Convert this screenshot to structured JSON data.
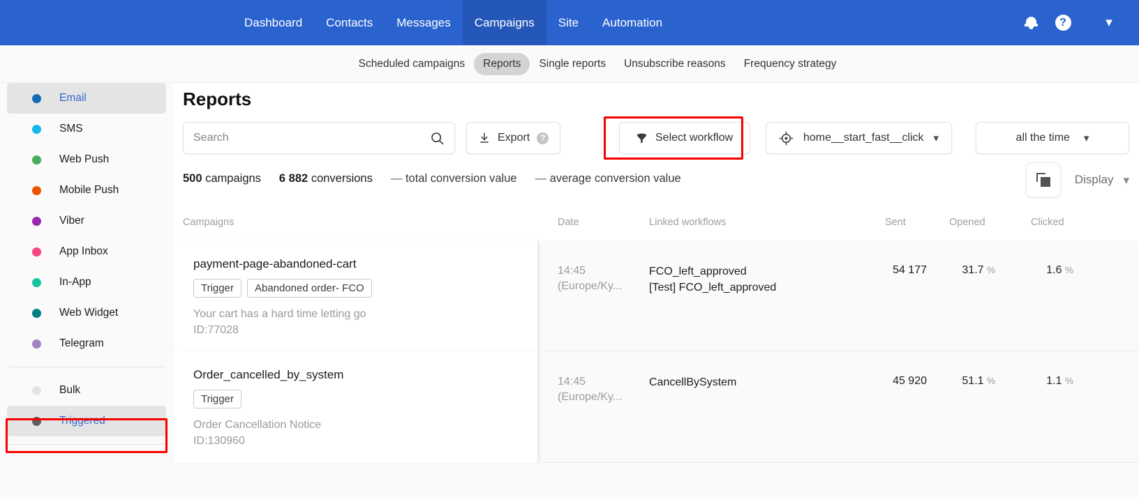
{
  "topnav": {
    "items": [
      {
        "label": "Dashboard",
        "active": false
      },
      {
        "label": "Contacts",
        "active": false
      },
      {
        "label": "Messages",
        "active": false
      },
      {
        "label": "Campaigns",
        "active": true
      },
      {
        "label": "Site",
        "active": false
      },
      {
        "label": "Automation",
        "active": false
      }
    ],
    "bell_icon": "bell-icon",
    "help_icon": "help-icon",
    "help_glyph": "?",
    "caret_glyph": "⌄",
    "bg_color": "#2a63ce",
    "active_bg_color": "#2557b8"
  },
  "subnav": {
    "items": [
      {
        "label": "Scheduled campaigns",
        "active": false
      },
      {
        "label": "Reports",
        "active": true
      },
      {
        "label": "Single reports",
        "active": false
      },
      {
        "label": "Unsubscribe reasons",
        "active": false
      },
      {
        "label": "Frequency strategy",
        "active": false
      }
    ]
  },
  "sidebar": {
    "channels": [
      {
        "label": "Email",
        "color": "#126cb5",
        "active": true
      },
      {
        "label": "SMS",
        "color": "#17b6ed",
        "active": false
      },
      {
        "label": "Web Push",
        "color": "#46ab5a",
        "active": false
      },
      {
        "label": "Mobile Push",
        "color": "#ea5504",
        "active": false
      },
      {
        "label": "Viber",
        "color": "#9b27b0",
        "active": false
      },
      {
        "label": "App Inbox",
        "color": "#f5447f",
        "active": false
      },
      {
        "label": "In-App",
        "color": "#17c3a0",
        "active": false
      },
      {
        "label": "Web Widget",
        "color": "#008080",
        "active": false
      },
      {
        "label": "Telegram",
        "color": "#a084c7",
        "active": false
      }
    ],
    "types": [
      {
        "label": "Bulk",
        "color": "#e4e4e4",
        "active": false
      },
      {
        "label": "Triggered",
        "color": "#5f5f5f",
        "active": true
      }
    ]
  },
  "main": {
    "page_title": "Reports",
    "search": {
      "value": "",
      "placeholder": "Search",
      "icon": "search-icon"
    },
    "export": {
      "label": "Export",
      "icon": "download-icon",
      "help_glyph": "?"
    },
    "select_workflow": {
      "label": "Select workflow",
      "icon": "funnel-icon"
    },
    "workflow_select": {
      "value": "home__start_fast__click",
      "icon": "target-icon",
      "caret": "⌄"
    },
    "period_select": {
      "value": "all the time",
      "caret": "⌄"
    },
    "copy_button": {
      "icon": "copy-icon"
    },
    "display": {
      "label": "Display",
      "caret": "⌄"
    },
    "stats": [
      {
        "value": "500",
        "label": "campaigns"
      },
      {
        "value": "6 882",
        "label": "conversions"
      },
      {
        "value": "—",
        "label": "total conversion value"
      },
      {
        "value": "—",
        "label": "average conversion value"
      }
    ],
    "table": {
      "headers": [
        "Campaigns",
        "Date",
        "Linked workflows",
        "Sent",
        "Opened",
        "Clicked"
      ],
      "rows": [
        {
          "name": "payment-page-abandoned-cart",
          "tags": [
            "Trigger",
            "Abandoned order- FCO"
          ],
          "subject": "Your cart has a hard time letting go",
          "id": "ID:77028",
          "time": "14:45",
          "timezone": "(Europe/Ky...",
          "workflows": [
            "FCO_left_approved",
            "[Test] FCO_left_approved"
          ],
          "sent": "54 177",
          "opened": "31.7",
          "clicked": "1.6"
        },
        {
          "name": "Order_cancelled_by_system",
          "tags": [
            "Trigger"
          ],
          "subject": "Order Cancellation Notice",
          "id": "ID:130960",
          "time": "14:45",
          "timezone": "(Europe/Ky...",
          "workflows": [
            "CancellBySystem"
          ],
          "sent": "45 920",
          "opened": "51.1",
          "clicked": "1.1"
        }
      ],
      "percent_symbol": "%"
    }
  },
  "highlights": {
    "color": "#f80000",
    "boxes": [
      "select-workflow-button",
      "sidebar-item-triggered"
    ]
  }
}
